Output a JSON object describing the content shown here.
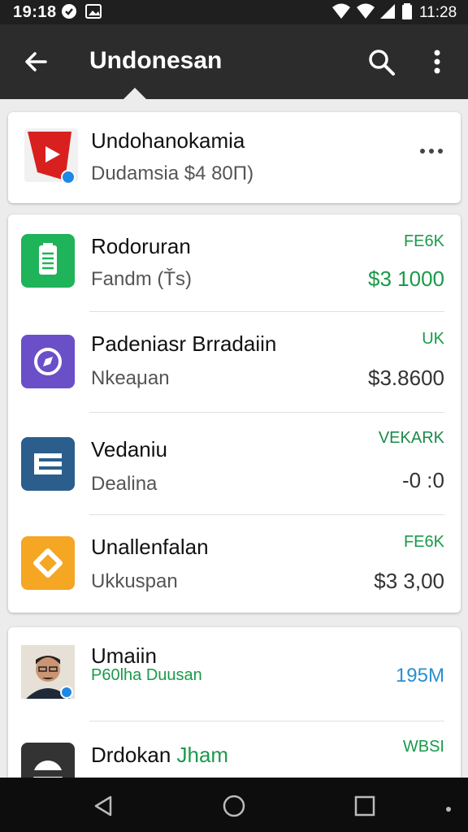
{
  "status_bar": {
    "time": "19:18",
    "right_time": "11:28"
  },
  "app_bar": {
    "title": "Undonesan"
  },
  "top_card": {
    "title": "Undohanokamia",
    "subtitle": "Dudamsia  $4 80Π)",
    "icon": "video-play-icon"
  },
  "items": [
    {
      "title": "Rodoruran",
      "subtitle": "Fandm (Ťs)",
      "tag": "FE6K",
      "amount": "$3 1000",
      "amount_color": "#1a9a4a",
      "tag_color": "#1a9a4a",
      "icon": "document-icon",
      "icon_color": "#1fb35a"
    },
    {
      "title": "Padeniasr Brradaiin",
      "subtitle": "Nkeaμan",
      "tag": "UK",
      "amount": "$3.8600",
      "amount_color": "#333333",
      "tag_color": "#1a9a4a",
      "icon": "compass-icon",
      "icon_color": "#6a4fc9"
    },
    {
      "title": "Vedaniu",
      "subtitle": "Dealina",
      "tag": "VEKARK",
      "amount": "-0 :0",
      "amount_color": "#333333",
      "tag_color": "#1a9a4a",
      "icon": "text-lines-icon",
      "icon_color": "#2b5e8c"
    },
    {
      "title": "Unallenfalan",
      "subtitle": "Ukkuspan",
      "tag": "FE6K",
      "amount": "$3 3,00",
      "amount_color": "#333333",
      "tag_color": "#1a9a4a",
      "icon": "tag-icon",
      "icon_color": "#f5a623"
    }
  ],
  "people": [
    {
      "name": "Umaiin",
      "subtitle": "P60lha Duusan",
      "tag": "195M",
      "tag_color": "#2a8fd0",
      "icon": "avatar"
    },
    {
      "name": "Drdokan",
      "name_green": "Jham",
      "tag": "WBSI",
      "tag_color": "#1a9a4a",
      "icon": "helmet-avatar"
    }
  ],
  "colors": {
    "app_bar": "#2c2c2c",
    "accent_green": "#1a9a4a",
    "accent_blue": "#2a8fd0"
  }
}
